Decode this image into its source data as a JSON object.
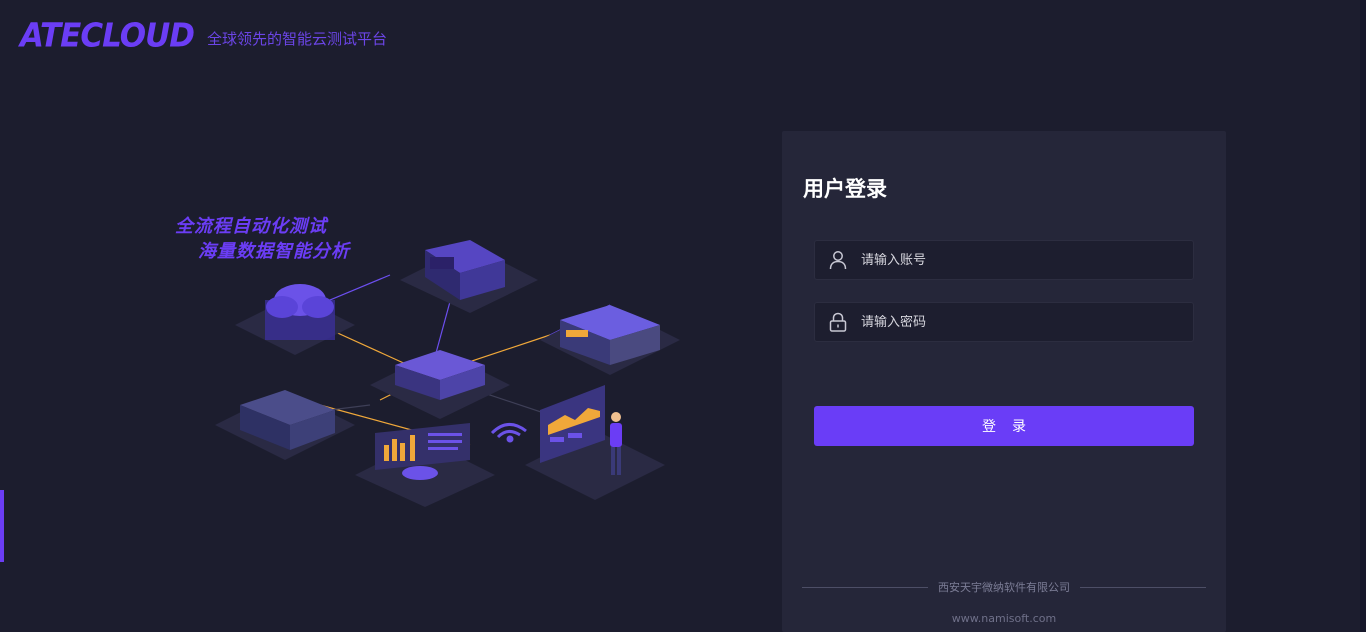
{
  "header": {
    "logo": "ATECLOUD",
    "slogan": "全球领先的智能云测试平台"
  },
  "illustration": {
    "line1": "全流程自动化测试",
    "line2": "海量数据智能分析"
  },
  "login": {
    "title": "用户登录",
    "username_placeholder": "请输入账号",
    "password_placeholder": "请输入密码",
    "submit_label": "登录"
  },
  "footer": {
    "company": "西安天宇微纳软件有限公司",
    "website": "www.namisoft.com"
  },
  "colors": {
    "background": "#1c1d2e",
    "panel": "#252639",
    "accent": "#6a3df7"
  },
  "icons": {
    "username": "user-icon",
    "password": "lock-icon"
  }
}
